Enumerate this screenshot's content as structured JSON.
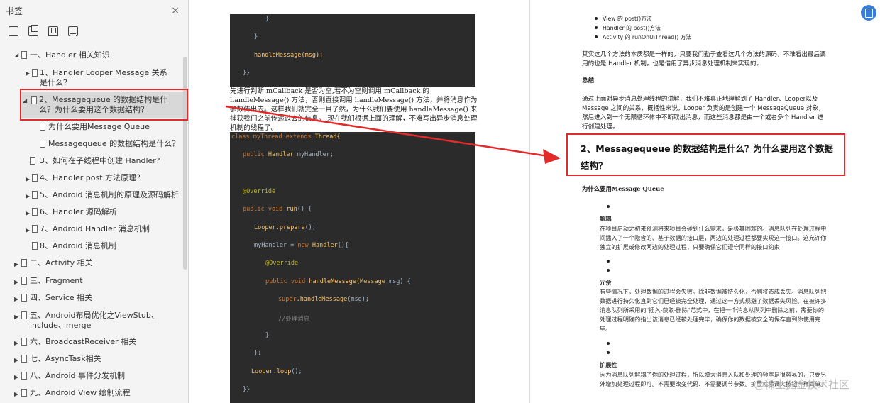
{
  "sidebar": {
    "title": "书签",
    "close_icon": "×",
    "items": [
      {
        "label": "一、Handler 相关知识",
        "expanded": true
      },
      {
        "label": "1、Handler Looper Message 关系是什么？"
      },
      {
        "label": "2、Messagequeue 的数据结构是什么？为什么要用这个数据结构？",
        "selected": true
      },
      {
        "label": "为什么要用Message Queue"
      },
      {
        "label": "Messagequeue 的数据结构是什么？"
      },
      {
        "label": "3、如何在子线程中创建 Handler?"
      },
      {
        "label": "4、Handler post 方法原理？"
      },
      {
        "label": "5、Android 消息机制的原理及源码解析"
      },
      {
        "label": "6、Handler 源码解析"
      },
      {
        "label": "7、Android Handler 消息机制"
      },
      {
        "label": "8、Android 消息机制"
      },
      {
        "label": "二、Activity 相关"
      },
      {
        "label": "三、Fragment"
      },
      {
        "label": "四、Service 相关"
      },
      {
        "label": "五、Android布局优化之ViewStub、include、merge"
      },
      {
        "label": "六、BroadcastReceiver 相关"
      },
      {
        "label": "七、AsyncTask相关"
      },
      {
        "label": "八、Android 事件分发机制"
      },
      {
        "label": "九、Android View 绘制流程"
      }
    ]
  },
  "middle": {
    "code1": [
      "}",
      "}",
      "handleMessage(msg);",
      "}}"
    ],
    "paragraph": "先进行判断 mCallback 是否为空,若不为空则调用 mCallback 的 handleMessage() 方法，否则直接调用 handleMessage() 方法，并将消息作为参数传出去。这样我们就完全一目了然，为什么我们要使用 handleMessage() 来捕获我们之前传递过去的信息。 现在我们根据上面的理解，不难写出异步消息处理机制的线程了。",
    "code2": {
      "l1a": "class myThread ",
      "l1b": "extends ",
      "l1c": "Thread{",
      "l2a": "public ",
      "l2b": "Handler ",
      "l2c": "myHandler;",
      "l3": "@Override",
      "l4a": "public void ",
      "l4b": "run",
      "l4c": "() {",
      "l5a": "Looper",
      "l5b": ".prepare",
      "l5c": "();",
      "l6a": "myHandler = ",
      "l6b": "new ",
      "l6c": "Handler",
      "l6d": "(){",
      "l7": "@Override",
      "l8a": "public void ",
      "l8b": "handleMessage",
      "l8c": "(Message ",
      "l8d": "msg) {",
      "l9a": "super",
      "l9b": ".handleMessage",
      "l9c": "(msg);",
      "l10": "//处理消息",
      "l11": "}",
      "l12": "};",
      "l13a": "Looper",
      "l13b": ".loop",
      "l13c": "();",
      "l14": "}}"
    }
  },
  "right": {
    "bullets_top": [
      "View 的 post()方法",
      "Handler 的 post()方法",
      "Activity 的 runOnUiThread() 方法"
    ],
    "para1": "其实这几个方法的本质都是一样的，只要我们勤于查看这几个方法的源码，不难看出最后调用的也是 Handler 机制，也是借用了异步消息处理机制来实现的。",
    "summary_title": "总结",
    "para2": "通过上面对异步消息处理线程的讲解，我们不难真正地理解到了 Handler、Looper以及 Message 之间的关系，概括性来说，Looper 负责的是创建一个 MessageQueue 对象，然后进入到一个无限循环体中不断取出消息，而这些消息都是由一个或者多个 Handler 进行创建处理。",
    "heading": "2、Messagequeue 的数据结构是什么？为什么要用这个数据结构？",
    "sub_heading": "为什么要用Message Queue",
    "decouple_title": "解耦",
    "decouple_text": "在项目启动之初来预测将来项目会碰到什么需求，是极其困难的。消息队列在处理过程中间插入了一个隐含的、基于数据的接口层，两边的处理过程都要实现这一接口。这允许你独立的扩展或修改两边的处理过程，只要确保它们遵守同样的接口约束",
    "redundancy_title": "冗余",
    "redundancy_text": "有些情况下，处理数据的过程会失败。除非数据被持久化，否则将造成丢失。消息队列把数据进行持久化直到它们已经被完全处理，通过这一方式规避了数据丢失风险。在被许多消息队列所采用的\"插入-获取-删除\"范式中，在把一个消息从队列中删除之前，需要你的处理过程明确的指出该消息已经被处理完毕，确保你的数据被安全的保存直到你使用完毕。",
    "scalability_title": "扩展性",
    "scalability_text": "因为消息队列解耦了你的处理过程，所以增大消息入队和处理的频率是很容易的，只要另外增加处理过程即可。不需要改变代码、不需要调节参数。扩展就像调大按钮一样简单。",
    "watermark": "@稀土掘金技术社区"
  },
  "colors": {
    "highlight": "#e32a2a",
    "code_bg": "#2b2b2b",
    "fab": "#3a7bd5"
  }
}
